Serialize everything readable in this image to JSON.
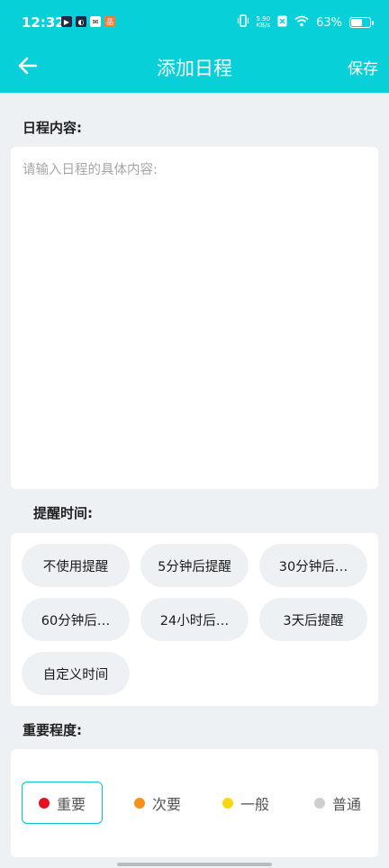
{
  "status": {
    "time": "12:32",
    "net_speed_value": "5.90",
    "net_speed_unit": "KB/s",
    "battery": "63%",
    "battery_level": 0.63,
    "app_icons": [
      "video-app-icon",
      "leaf-app-icon",
      "mail-app-icon",
      "shop-app-icon"
    ]
  },
  "header": {
    "title": "添加日程",
    "save_label": "保存"
  },
  "content": {
    "label": "日程内容:",
    "placeholder": "请输入日程的具体内容:"
  },
  "reminder": {
    "label": "提醒时间:",
    "options": [
      "不使用提醒",
      "5分钟后提醒",
      "30分钟后…",
      "60分钟后…",
      "24小时后…",
      "3天后提醒",
      "自定义时间"
    ]
  },
  "importance": {
    "label": "重要程度:",
    "options": [
      {
        "label": "重要",
        "color": "#e8101f",
        "selected": true
      },
      {
        "label": "次要",
        "color": "#f5901e",
        "selected": false
      },
      {
        "label": "一般",
        "color": "#f7d810",
        "selected": false
      },
      {
        "label": "普通",
        "color": "#cfcfcf",
        "selected": false
      }
    ]
  },
  "colors": {
    "accent": "#07d0d8"
  }
}
